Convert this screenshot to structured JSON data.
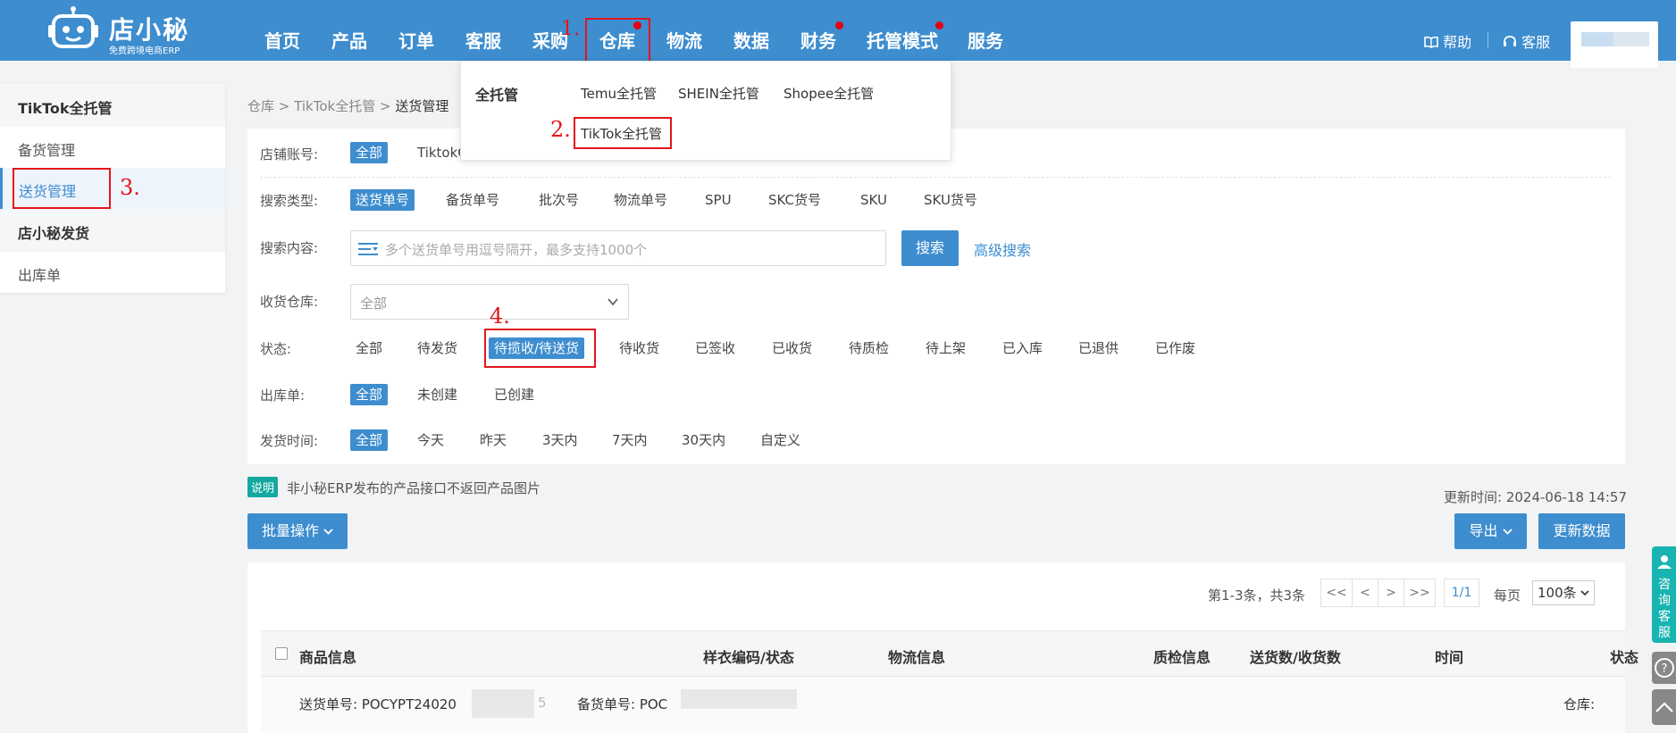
{
  "app": {
    "logo_name": "店小秘",
    "logo_sub": "免费跨境电商ERP"
  },
  "nav": {
    "items": [
      {
        "label": "首页"
      },
      {
        "label": "产品"
      },
      {
        "label": "订单"
      },
      {
        "label": "客服"
      },
      {
        "label": "采购"
      },
      {
        "label": "仓库"
      },
      {
        "label": "物流"
      },
      {
        "label": "数据"
      },
      {
        "label": "财务"
      },
      {
        "label": "托管模式"
      },
      {
        "label": "服务"
      }
    ],
    "help": "帮助",
    "support": "客服"
  },
  "steps": {
    "s1": "1.",
    "s2": "2.",
    "s3": "3.",
    "s4": "4."
  },
  "dropdown": {
    "heading": "全托管",
    "items": [
      {
        "label": "Temu全托管"
      },
      {
        "label": "SHEIN全托管"
      },
      {
        "label": "Shopee全托管"
      },
      {
        "label": "TikTok全托管"
      }
    ]
  },
  "sidebar": {
    "sections": [
      {
        "title": "TikTok全托管",
        "items": [
          {
            "label": "备货管理"
          },
          {
            "label": "送货管理"
          }
        ]
      },
      {
        "title": "店小秘发货",
        "items": [
          {
            "label": "出库单"
          }
        ]
      }
    ]
  },
  "breadcrumb": {
    "a": "仓库",
    "b": "TikTok全托管",
    "c": "送货管理",
    "sep": ">"
  },
  "filters": {
    "store": {
      "label": "店铺账号:",
      "options": [
        "全部",
        "TiktokG"
      ]
    },
    "search_type": {
      "label": "搜索类型:",
      "options": [
        "送货单号",
        "备货单号",
        "批次号",
        "物流单号",
        "SPU",
        "SKC货号",
        "SKU",
        "SKU货号"
      ]
    },
    "search_content": {
      "label": "搜索内容:",
      "placeholder": "多个送货单号用逗号隔开，最多支持1000个",
      "button": "搜索",
      "advanced": "高级搜索"
    },
    "warehouse": {
      "label": "收货仓库:",
      "value": "全部"
    },
    "status": {
      "label": "状态:",
      "options": [
        "全部",
        "待发货",
        "待揽收/待送货",
        "待收货",
        "已签收",
        "已收货",
        "待质检",
        "待上架",
        "已入库",
        "已退供",
        "已作废"
      ]
    },
    "outbound": {
      "label": "出库单:",
      "options": [
        "全部",
        "未创建",
        "已创建"
      ]
    },
    "ship_time": {
      "label": "发货时间:",
      "options": [
        "全部",
        "今天",
        "昨天",
        "3天内",
        "7天内",
        "30天内",
        "自定义"
      ]
    }
  },
  "notice": {
    "tag": "说明",
    "text": "非小秘ERP发布的产品接口不返回产品图片",
    "update_time": "更新时间: 2024-06-18 14:57"
  },
  "actions": {
    "bulk": "批量操作",
    "export": "导出",
    "refresh": "更新数据"
  },
  "pagination": {
    "count": "第1-3条，共3条",
    "first": "<<",
    "prev": "<",
    "next": ">",
    "last": ">>",
    "page": "1/1",
    "per_page_label": "每页",
    "per_page": "100条"
  },
  "table": {
    "headers": [
      "商品信息",
      "样衣编码/状态",
      "物流信息",
      "质检信息",
      "送货数/收货数",
      "时间",
      "状态"
    ],
    "row1": {
      "delivery_no": "送货单号: POCYPT24020",
      "delivery_tail": "5",
      "stock_no": "备货单号: POC",
      "warehouse": "仓库:"
    }
  },
  "float": {
    "consult": "咨询客服",
    "help": "?"
  },
  "colors": {
    "topbar": "#3d8dcf",
    "accent": "#3d8dcf",
    "highlight_box": "#e4141b",
    "notice_tag": "#13a8a0",
    "float_consult": "#18b4b1"
  },
  "icons": [
    "robot-logo-icon",
    "book-icon",
    "headset-icon",
    "list-icon",
    "chevron-down-icon",
    "person-icon",
    "question-icon",
    "arrow-up-icon"
  ]
}
